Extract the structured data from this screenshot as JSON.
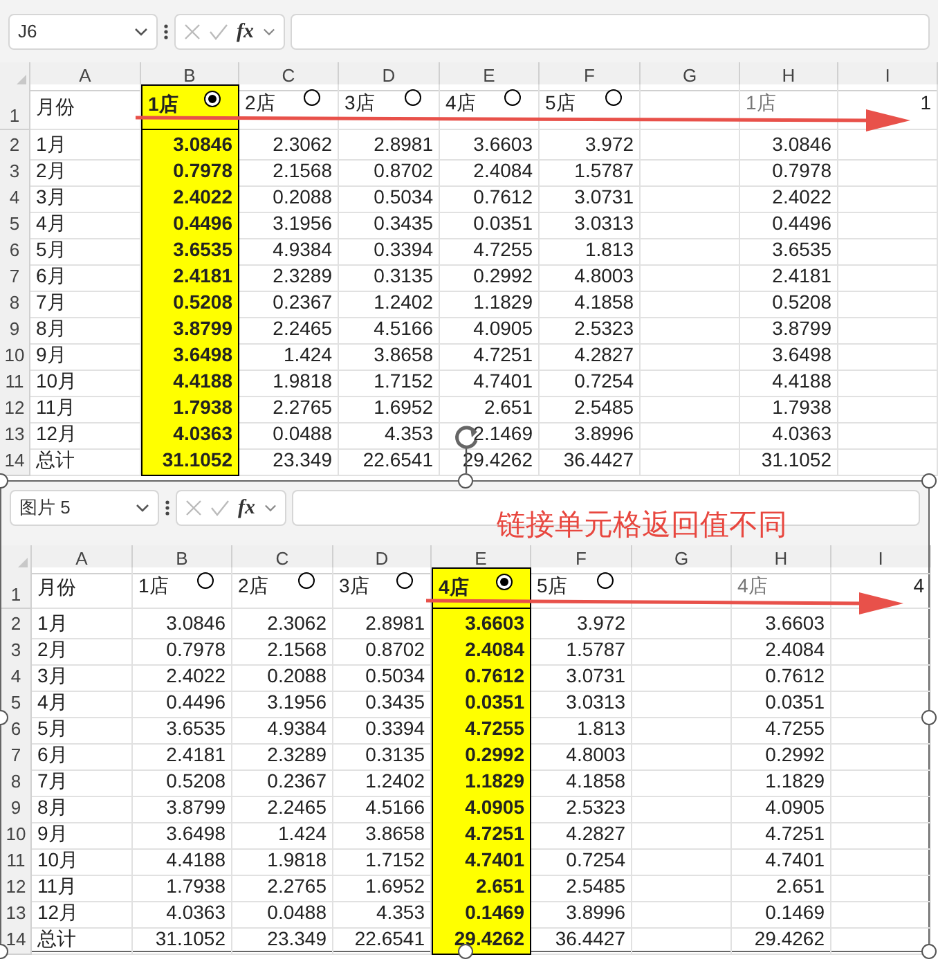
{
  "panels": [
    {
      "name_box": "J6",
      "function_label": "fx",
      "columns": [
        "A",
        "B",
        "C",
        "D",
        "E",
        "F",
        "G",
        "H",
        "I"
      ],
      "header_row": {
        "row_number": "1",
        "label": "月份",
        "stores": [
          {
            "label": "1店",
            "selected": true
          },
          {
            "label": "2店",
            "selected": false
          },
          {
            "label": "3店",
            "selected": false
          },
          {
            "label": "4店",
            "selected": false
          },
          {
            "label": "5店",
            "selected": false
          }
        ],
        "result_label": "1店",
        "link_value": "1"
      },
      "rows": [
        {
          "row_number": "2",
          "label": "1月",
          "values": [
            "3.0846",
            "2.3062",
            "2.8981",
            "3.6603",
            "3.972"
          ],
          "result": "3.0846"
        },
        {
          "row_number": "3",
          "label": "2月",
          "values": [
            "0.7978",
            "2.1568",
            "0.8702",
            "2.4084",
            "1.5787"
          ],
          "result": "0.7978"
        },
        {
          "row_number": "4",
          "label": "3月",
          "values": [
            "2.4022",
            "0.2088",
            "0.5034",
            "0.7612",
            "3.0731"
          ],
          "result": "2.4022"
        },
        {
          "row_number": "5",
          "label": "4月",
          "values": [
            "0.4496",
            "3.1956",
            "0.3435",
            "0.0351",
            "3.0313"
          ],
          "result": "0.4496"
        },
        {
          "row_number": "6",
          "label": "5月",
          "values": [
            "3.6535",
            "4.9384",
            "0.3394",
            "4.7255",
            "1.813"
          ],
          "result": "3.6535"
        },
        {
          "row_number": "7",
          "label": "6月",
          "values": [
            "2.4181",
            "2.3289",
            "0.3135",
            "0.2992",
            "4.8003"
          ],
          "result": "2.4181"
        },
        {
          "row_number": "8",
          "label": "7月",
          "values": [
            "0.5208",
            "0.2367",
            "1.2402",
            "1.1829",
            "4.1858"
          ],
          "result": "0.5208"
        },
        {
          "row_number": "9",
          "label": "8月",
          "values": [
            "3.8799",
            "2.2465",
            "4.5166",
            "4.0905",
            "2.5323"
          ],
          "result": "3.8799"
        },
        {
          "row_number": "10",
          "label": "9月",
          "values": [
            "3.6498",
            "1.424",
            "3.8658",
            "4.7251",
            "4.2827"
          ],
          "result": "3.6498"
        },
        {
          "row_number": "11",
          "label": "10月",
          "values": [
            "4.4188",
            "1.9818",
            "1.7152",
            "4.7401",
            "0.7254"
          ],
          "result": "4.4188"
        },
        {
          "row_number": "12",
          "label": "11月",
          "values": [
            "1.7938",
            "2.2765",
            "1.6952",
            "2.651",
            "2.5485"
          ],
          "result": "1.7938"
        },
        {
          "row_number": "13",
          "label": "12月",
          "values": [
            "4.0363",
            "0.0488",
            "4.353",
            "2.1469",
            "3.8996"
          ],
          "result": "4.0363"
        },
        {
          "row_number": "14",
          "label": "总计",
          "values": [
            "31.1052",
            "23.349",
            "22.6541",
            "29.4262",
            "36.4427"
          ],
          "result": "31.1052"
        }
      ]
    },
    {
      "name_box": "图片 5",
      "function_label": "fx",
      "annotation": "链接单元格返回值不同",
      "columns": [
        "A",
        "B",
        "C",
        "D",
        "E",
        "F",
        "G",
        "H",
        "I"
      ],
      "header_row": {
        "row_number": "1",
        "label": "月份",
        "stores": [
          {
            "label": "1店",
            "selected": false
          },
          {
            "label": "2店",
            "selected": false
          },
          {
            "label": "3店",
            "selected": false
          },
          {
            "label": "4店",
            "selected": true
          },
          {
            "label": "5店",
            "selected": false
          }
        ],
        "result_label": "4店",
        "link_value": "4"
      },
      "rows": [
        {
          "row_number": "2",
          "label": "1月",
          "values": [
            "3.0846",
            "2.3062",
            "2.8981",
            "3.6603",
            "3.972"
          ],
          "result": "3.6603"
        },
        {
          "row_number": "3",
          "label": "2月",
          "values": [
            "0.7978",
            "2.1568",
            "0.8702",
            "2.4084",
            "1.5787"
          ],
          "result": "2.4084"
        },
        {
          "row_number": "4",
          "label": "3月",
          "values": [
            "2.4022",
            "0.2088",
            "0.5034",
            "0.7612",
            "3.0731"
          ],
          "result": "0.7612"
        },
        {
          "row_number": "5",
          "label": "4月",
          "values": [
            "0.4496",
            "3.1956",
            "0.3435",
            "0.0351",
            "3.0313"
          ],
          "result": "0.0351"
        },
        {
          "row_number": "6",
          "label": "5月",
          "values": [
            "3.6535",
            "4.9384",
            "0.3394",
            "4.7255",
            "1.813"
          ],
          "result": "4.7255"
        },
        {
          "row_number": "7",
          "label": "6月",
          "values": [
            "2.4181",
            "2.3289",
            "0.3135",
            "0.2992",
            "4.8003"
          ],
          "result": "0.2992"
        },
        {
          "row_number": "8",
          "label": "7月",
          "values": [
            "0.5208",
            "0.2367",
            "1.2402",
            "1.1829",
            "4.1858"
          ],
          "result": "1.1829"
        },
        {
          "row_number": "9",
          "label": "8月",
          "values": [
            "3.8799",
            "2.2465",
            "4.5166",
            "4.0905",
            "2.5323"
          ],
          "result": "4.0905"
        },
        {
          "row_number": "10",
          "label": "9月",
          "values": [
            "3.6498",
            "1.424",
            "3.8658",
            "4.7251",
            "4.2827"
          ],
          "result": "4.7251"
        },
        {
          "row_number": "11",
          "label": "10月",
          "values": [
            "4.4188",
            "1.9818",
            "1.7152",
            "4.7401",
            "0.7254"
          ],
          "result": "4.7401"
        },
        {
          "row_number": "12",
          "label": "11月",
          "values": [
            "1.7938",
            "2.2765",
            "1.6952",
            "2.651",
            "2.5485"
          ],
          "result": "2.651"
        },
        {
          "row_number": "13",
          "label": "12月",
          "values": [
            "4.0363",
            "0.0488",
            "4.353",
            "0.1469",
            "3.8996"
          ],
          "result": "0.1469"
        },
        {
          "row_number": "14",
          "label": "总计",
          "values": [
            "31.1052",
            "23.349",
            "22.6541",
            "29.4262",
            "36.4427"
          ],
          "result": "29.4262"
        }
      ]
    }
  ]
}
